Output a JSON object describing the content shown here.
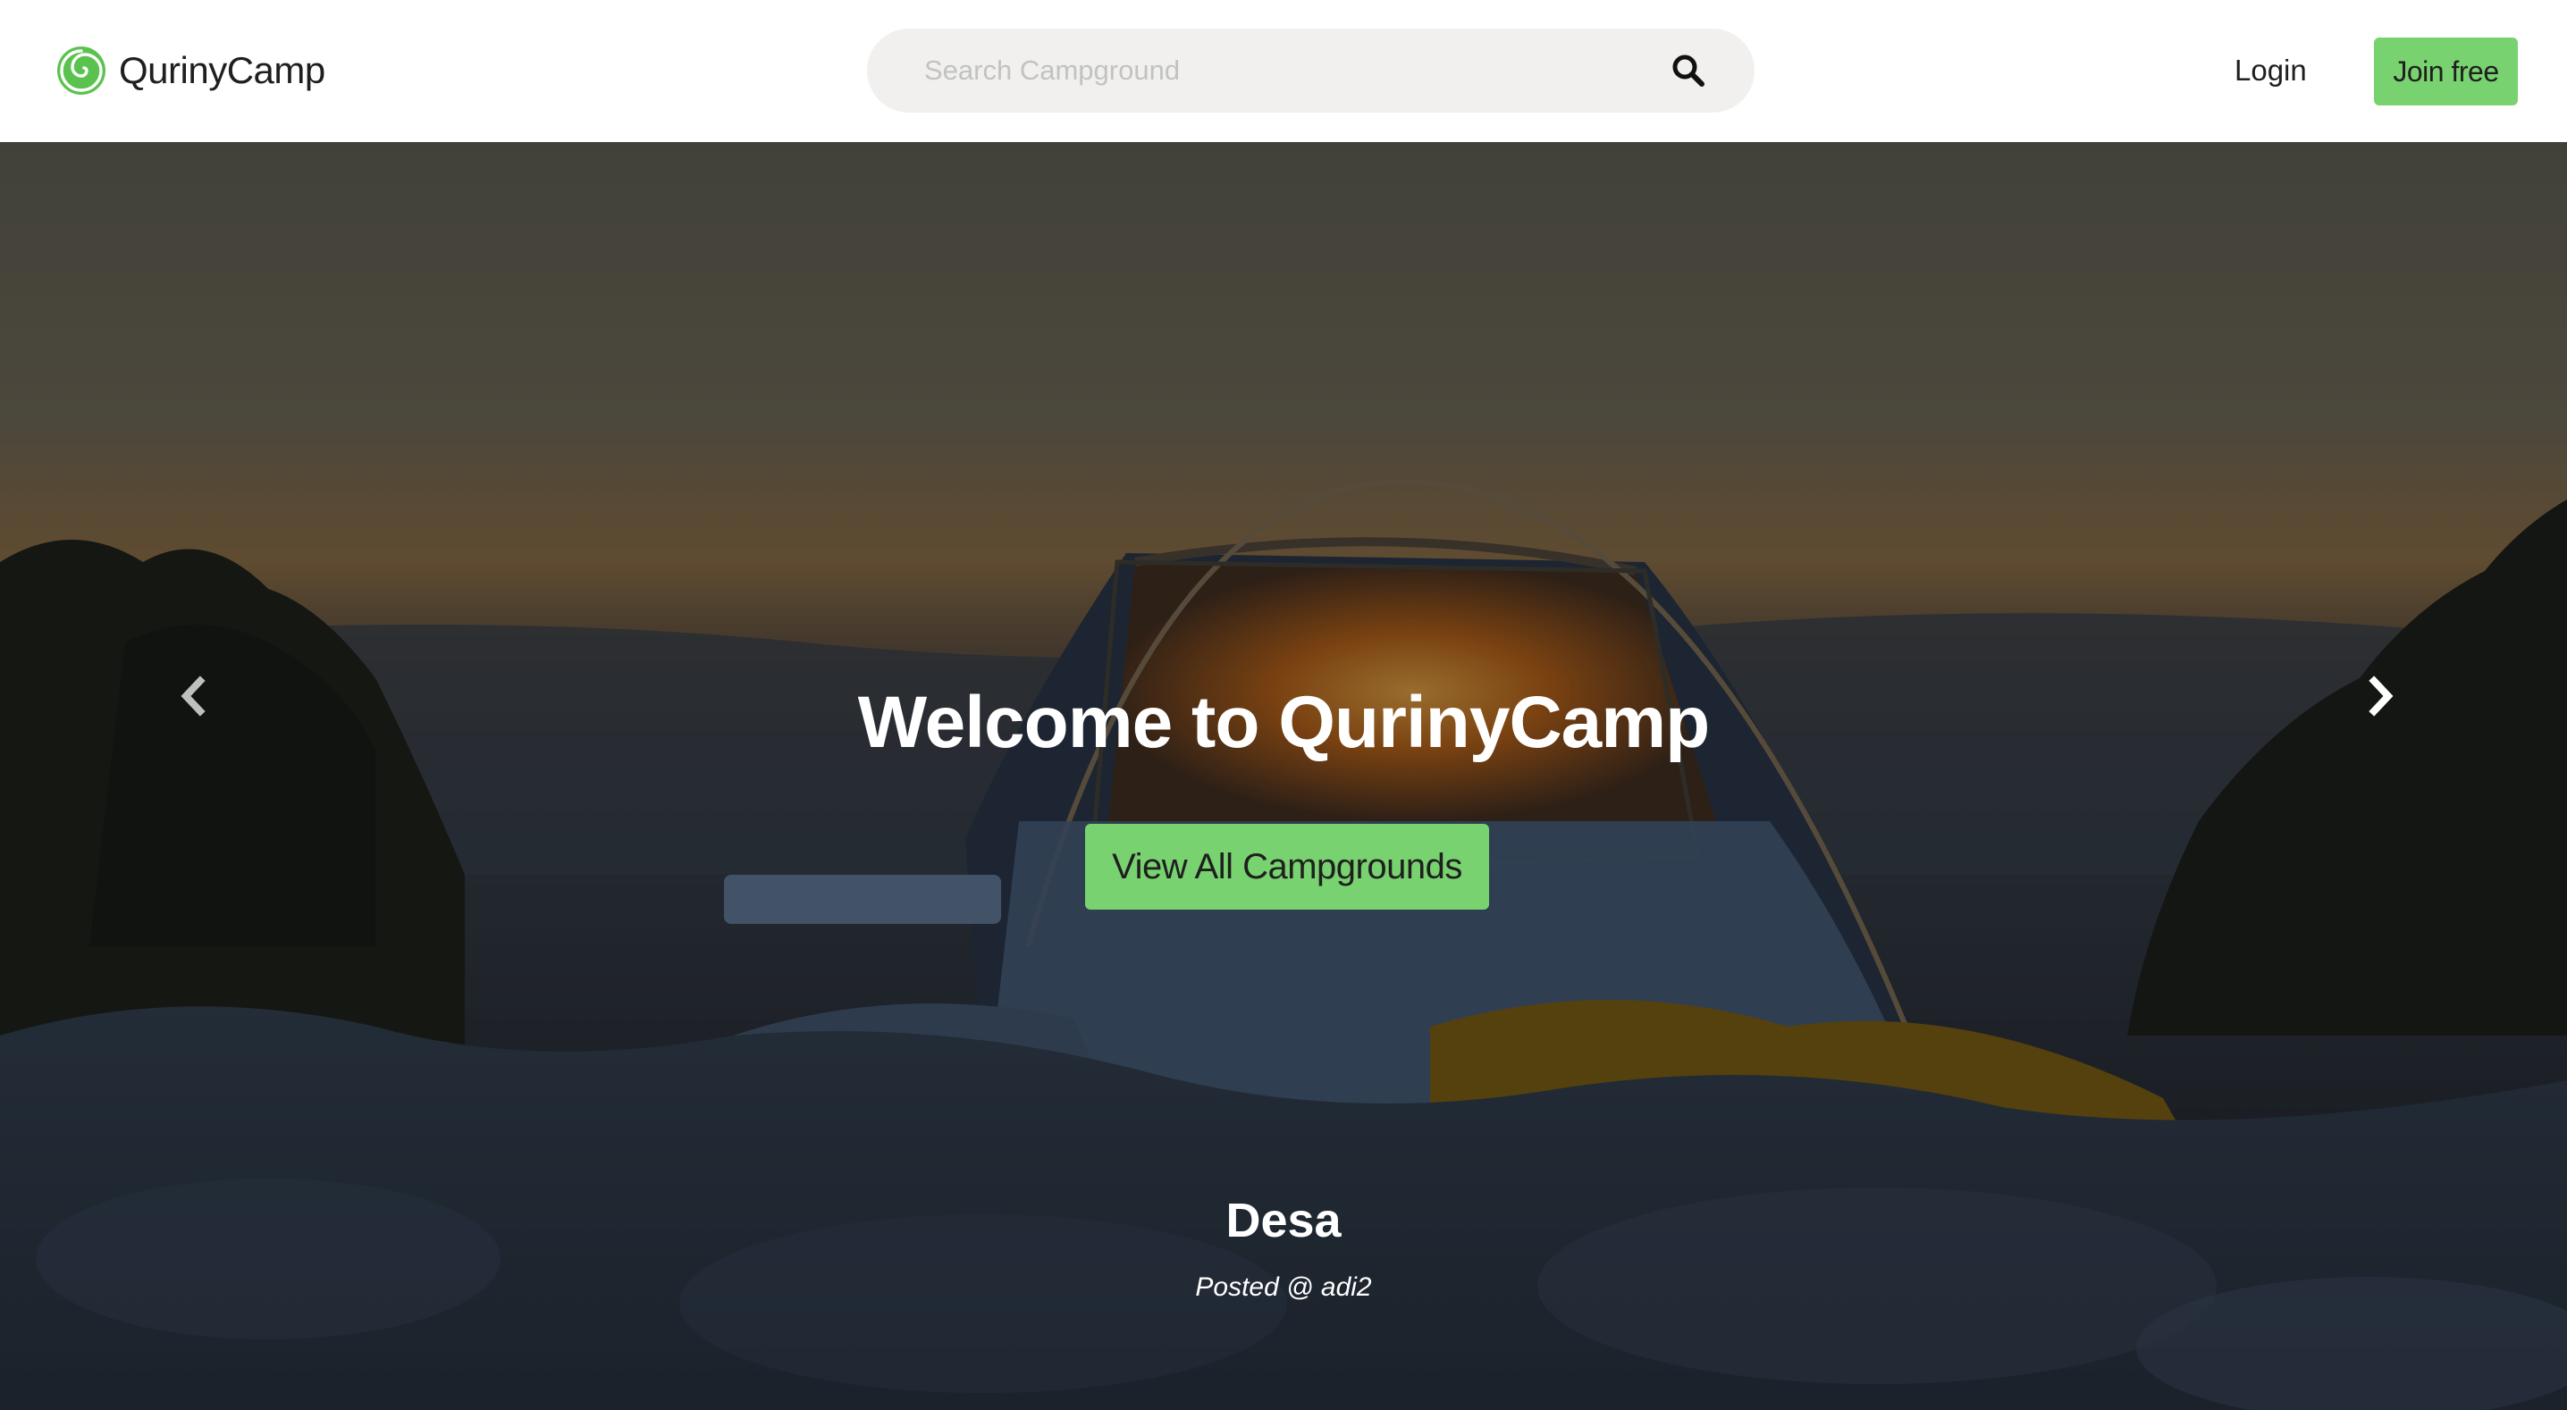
{
  "header": {
    "brand_name": "QurinyCamp",
    "logo_icon": "spiral-logo-icon",
    "brand_color": "#5cc24f",
    "search": {
      "placeholder": "Search Campground",
      "value": "",
      "icon": "search-icon"
    },
    "login_label": "Login",
    "join_label": "Join free",
    "accent_color": "#78d26f"
  },
  "hero": {
    "title": "Welcome to QurinyCamp",
    "cta_label": "View All Campgrounds",
    "prev_icon": "chevron-left-icon",
    "next_icon": "chevron-right-icon",
    "caption": {
      "title": "Desa",
      "subtitle": "Posted @ adi2"
    }
  }
}
